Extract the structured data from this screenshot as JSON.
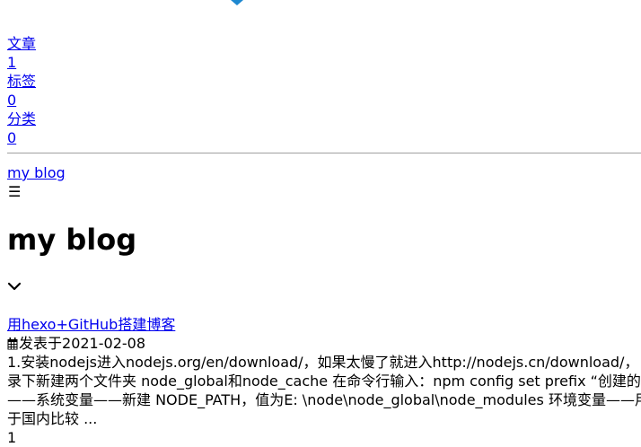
{
  "stats": {
    "articles_label": "文章",
    "articles_count": "1",
    "tags_label": "标签",
    "tags_count": "0",
    "categories_label": "分类",
    "categories_count": "0"
  },
  "header": {
    "brand": "my blog",
    "menu_icon": "hamburger-icon",
    "site_title": "my blog",
    "expand_icon": "chevron-down-icon"
  },
  "post": {
    "title": "用hexo+GitHub搭建博客",
    "meta_icon": "calendar-icon",
    "meta_prefix": "发表于",
    "date": "2021-02-08",
    "excerpt_lines": [
      "1.安装nodejs进入nodejs.org/en/download/，如果太慢了就进入http://nodejs.cn/download/， 进入",
      "录下新建两个文件夹 node_global和node_cache 在命令行输入：npm config set prefix “创建的node_",
      "——系统变量——新建 NODE_PATH，值为E: \\node\\node_global\\node_modules 环境变量——用户变",
      "于国内比较 ..."
    ]
  },
  "pagination": {
    "page": "1"
  },
  "colors": {
    "link": "#0000ee",
    "text": "#000000",
    "top_icon": "#1e88d0",
    "separator": "#a0a0a0"
  }
}
